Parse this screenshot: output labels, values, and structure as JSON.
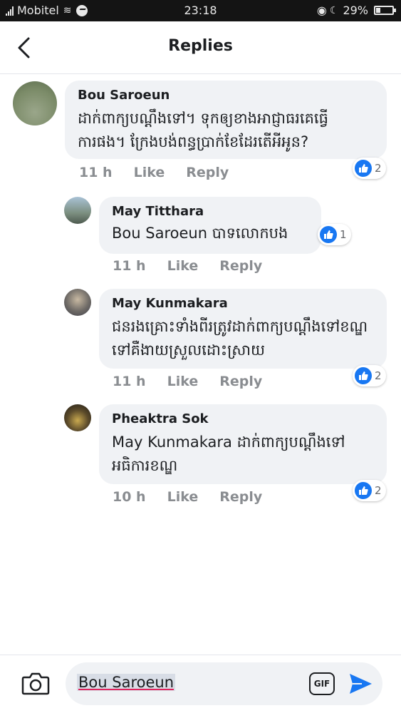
{
  "status_bar": {
    "carrier": "Mobitel",
    "time": "23:18",
    "battery": "29%"
  },
  "header": {
    "title": "Replies"
  },
  "comments": [
    {
      "author": "Bou Saroeun",
      "text": "ដាក់ពាក្យបណ្ដឹងទៅ។ ទុកឲ្យខាងអាជ្ញាធរគេធ្វើការផង។ ក្រែងបង់ពន្ធប្រាក់ខែដែរតើអីអូន?",
      "time": "11 h",
      "like_label": "Like",
      "reply_label": "Reply",
      "reactions": "2"
    },
    {
      "author": "May Titthara",
      "text": "Bou Saroeun បាទលោកបង",
      "time": "11 h",
      "like_label": "Like",
      "reply_label": "Reply",
      "reactions": "1"
    },
    {
      "author": "May Kunmakara",
      "text": "ជនរងគ្រោះទាំងពីរត្រូវដាក់ពាក្យបណ្ដឹងទៅខណ្ឌទៅគឺងាយស្រួលដោះស្រាយ",
      "time": "11 h",
      "like_label": "Like",
      "reply_label": "Reply",
      "reactions": "2"
    },
    {
      "author": "Pheaktra Sok",
      "text": "May Kunmakara ដាក់ពាក្យបណ្ដឹងទៅអធិការខណ្ឌ",
      "time": "10 h",
      "like_label": "Like",
      "reply_label": "Reply",
      "reactions": "2"
    }
  ],
  "composer": {
    "value": "Bou Saroeun",
    "gif_label": "GIF"
  },
  "colors": {
    "accent": "#1877f2",
    "bubble": "#f0f2f5",
    "meta": "#8a8d91"
  }
}
